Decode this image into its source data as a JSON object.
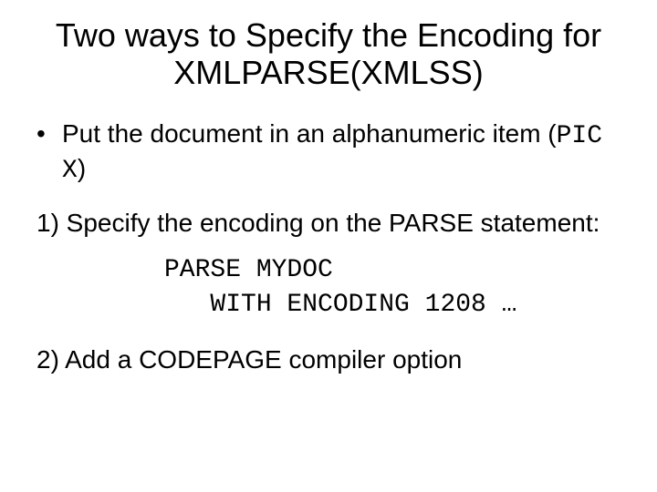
{
  "title": "Two ways to Specify the Encoding for XMLPARSE(XMLSS)",
  "bullet": {
    "prefix": "Put the document in an alphanumeric item (",
    "code": "PIC X",
    "suffix": ")"
  },
  "item1": "1) Specify the encoding on the PARSE statement:",
  "code": "PARSE MYDOC\n   WITH ENCODING 1208 …",
  "item2": "2) Add a CODEPAGE compiler option"
}
